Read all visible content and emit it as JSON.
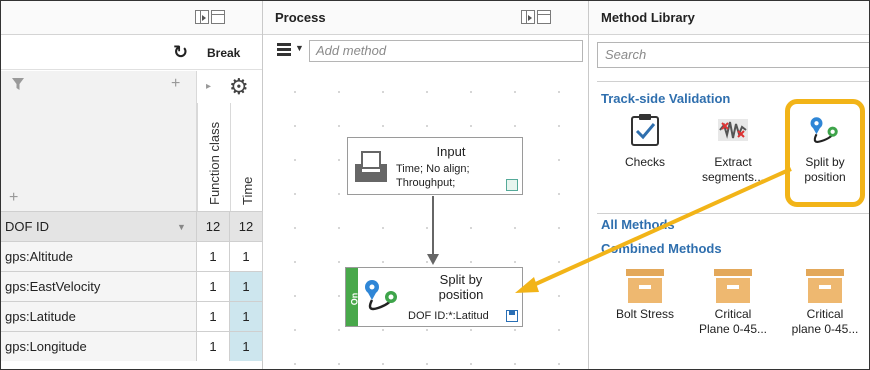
{
  "left_panel": {
    "refresh_icon": "refresh-icon",
    "break_label": "Break",
    "col_headers": [
      "Function class",
      "Time"
    ],
    "grid_header": {
      "label": "DOF ID",
      "c1": "12",
      "c2": "12"
    },
    "rows": [
      {
        "name": "gps:Altitude",
        "c1": "1",
        "c2": "1",
        "hl": false
      },
      {
        "name": "gps:EastVelocity",
        "c1": "1",
        "c2": "1",
        "hl": true
      },
      {
        "name": "gps:Latitude",
        "c1": "1",
        "c2": "1",
        "hl": true
      },
      {
        "name": "gps:Longitude",
        "c1": "1",
        "c2": "1",
        "hl": true
      }
    ]
  },
  "process_panel": {
    "title": "Process",
    "add_method_placeholder": "Add method",
    "input_node": {
      "title": "Input",
      "lines": [
        "Time; No align;",
        "Throughput;"
      ]
    },
    "split_node": {
      "on_label": "On",
      "title_line1": "Split by",
      "title_line2": "position",
      "subtitle": "DOF ID:*:Latitud"
    }
  },
  "library_panel": {
    "title": "Method Library",
    "search_placeholder": "Search",
    "track_side_title": "Track-side Validation",
    "track_side_items": [
      {
        "line1": "Checks",
        "line2": ""
      },
      {
        "line1": "Extract",
        "line2": "segments..."
      },
      {
        "line1": "Split by",
        "line2": "position"
      }
    ],
    "all_methods_title": "All Methods",
    "combined_title": "Combined Methods",
    "combined_items": [
      {
        "line1": "Bolt Stress",
        "line2": ""
      },
      {
        "line1": "Critical",
        "line2": "Plane 0-45..."
      },
      {
        "line1": "Critical",
        "line2": "plane 0-45..."
      }
    ]
  },
  "colors": {
    "accent_blue": "#2f6fae",
    "highlight_orange": "#f2b418",
    "on_green": "#48a84a",
    "cell_highlight": "#cde6ee"
  }
}
